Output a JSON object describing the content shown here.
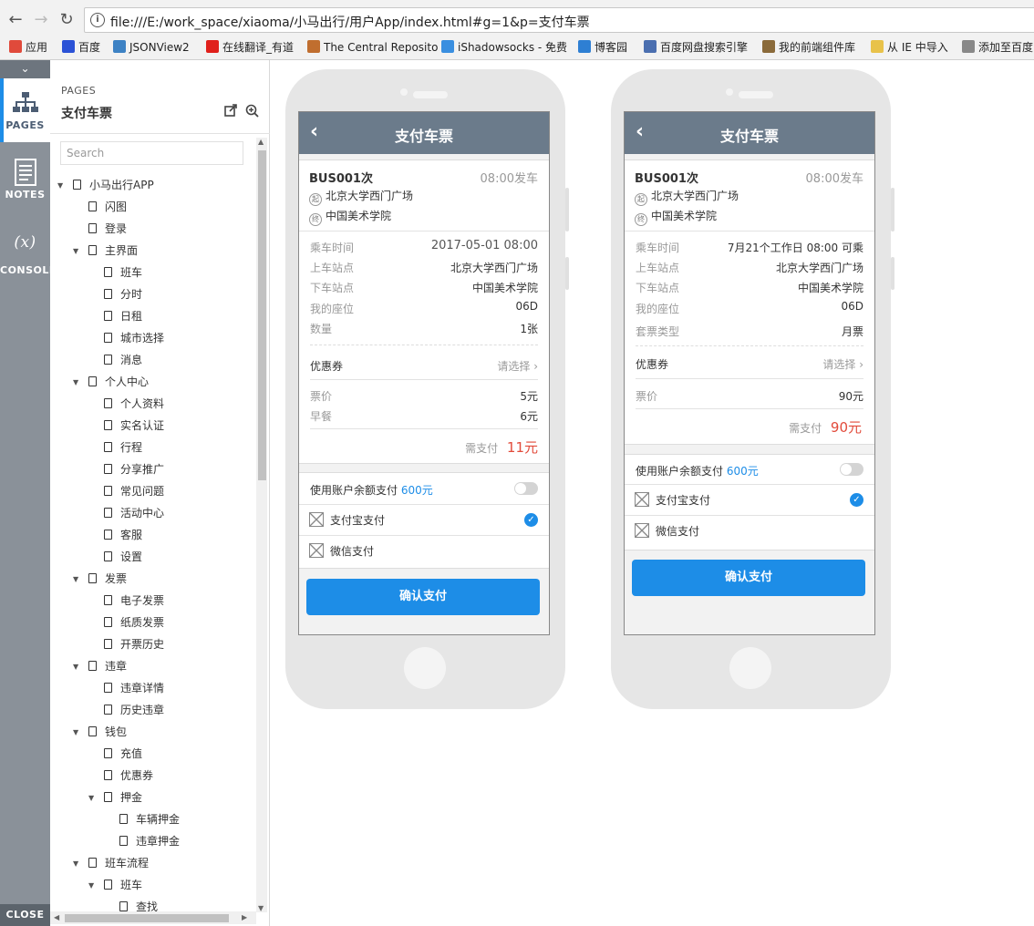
{
  "browser": {
    "url": "file:///E:/work_space/xiaoma/小马出行/用户App/index.html#g=1&p=支付车票",
    "bookmarks": [
      {
        "label": "应用",
        "color": "#e04a3b"
      },
      {
        "label": "百度",
        "color": "#2b52d6"
      },
      {
        "label": "JSONView2",
        "color": "#3d82c4"
      },
      {
        "label": "在线翻译_有道",
        "color": "#e0201b"
      },
      {
        "label": "The Central Reposito",
        "color": "#c06e2f"
      },
      {
        "label": "iShadowsocks - 免费",
        "color": "#3a8fe0"
      },
      {
        "label": "博客园",
        "color": "#2e7fd3"
      },
      {
        "label": "百度网盘搜索引擎",
        "color": "#4b6fb0"
      },
      {
        "label": "我的前端组件库",
        "color": "#8a6a3a"
      },
      {
        "label": "从 IE 中导入",
        "color": "#e8c24a"
      },
      {
        "label": "添加至百度",
        "color": "#888888"
      }
    ]
  },
  "iconbar": {
    "items": [
      {
        "label": "PAGES",
        "icon": "sitemap-icon"
      },
      {
        "label": "NOTES",
        "icon": "notes-icon"
      },
      {
        "label": "CONSOLE",
        "icon": "variable-icon",
        "glyph": "(x)"
      }
    ],
    "close_label": "CLOSE"
  },
  "pages_panel": {
    "section_label": "PAGES",
    "current_page": "支付车票",
    "search_placeholder": "Search",
    "tree": [
      {
        "label": "小马出行APP",
        "level": 0,
        "expanded": true
      },
      {
        "label": "闪图",
        "level": 1
      },
      {
        "label": "登录",
        "level": 1
      },
      {
        "label": "主界面",
        "level": 1,
        "expanded": true
      },
      {
        "label": "班车",
        "level": 2
      },
      {
        "label": "分时",
        "level": 2
      },
      {
        "label": "日租",
        "level": 2
      },
      {
        "label": "城市选择",
        "level": 2
      },
      {
        "label": "消息",
        "level": 2
      },
      {
        "label": "个人中心",
        "level": 1,
        "expanded": true
      },
      {
        "label": "个人资料",
        "level": 2
      },
      {
        "label": "实名认证",
        "level": 2
      },
      {
        "label": "行程",
        "level": 2
      },
      {
        "label": "分享推广",
        "level": 2
      },
      {
        "label": "常见问题",
        "level": 2
      },
      {
        "label": "活动中心",
        "level": 2
      },
      {
        "label": "客服",
        "level": 2
      },
      {
        "label": "设置",
        "level": 2
      },
      {
        "label": "发票",
        "level": 1,
        "expanded": true
      },
      {
        "label": "电子发票",
        "level": 2
      },
      {
        "label": "纸质发票",
        "level": 2
      },
      {
        "label": "开票历史",
        "level": 2
      },
      {
        "label": "违章",
        "level": 1,
        "expanded": true
      },
      {
        "label": "违章详情",
        "level": 2
      },
      {
        "label": "历史违章",
        "level": 2
      },
      {
        "label": "钱包",
        "level": 1,
        "expanded": true
      },
      {
        "label": "充值",
        "level": 2
      },
      {
        "label": "优惠券",
        "level": 2
      },
      {
        "label": "押金",
        "level": 2,
        "expanded": true
      },
      {
        "label": "车辆押金",
        "level": 3
      },
      {
        "label": "违章押金",
        "level": 3
      },
      {
        "label": "班车流程",
        "level": 1,
        "expanded": true
      },
      {
        "label": "班车",
        "level": 2,
        "expanded": true
      },
      {
        "label": "查找",
        "level": 3
      }
    ]
  },
  "phone1": {
    "title": "支付车票",
    "bus": "BUS001次",
    "depart": "08:00发车",
    "start_badge": "起",
    "start": "北京大学西门广场",
    "end_badge": "终",
    "end": "中国美术学院",
    "rows": [
      {
        "label": "乘车时间",
        "value": "2017-05-01 08:00"
      },
      {
        "label": "上车站点",
        "value": "北京大学西门广场"
      },
      {
        "label": "下车站点",
        "value": "中国美术学院"
      },
      {
        "label": "我的座位",
        "value": "06D"
      },
      {
        "label": "数量",
        "value": "1张"
      }
    ],
    "coupon_label": "优惠券",
    "coupon_value": "请选择",
    "prices": [
      {
        "label": "票价",
        "value": "5元"
      },
      {
        "label": "早餐",
        "value": "6元"
      }
    ],
    "total_label": "需支付",
    "total_value": "11元",
    "balance_label": "使用账户余额支付",
    "balance_value": "600元",
    "pay_alipay": "支付宝支付",
    "pay_wechat": "微信支付",
    "confirm": "确认支付"
  },
  "phone2": {
    "title": "支付车票",
    "bus": "BUS001次",
    "depart": "08:00发车",
    "start_badge": "起",
    "start": "北京大学西门广场",
    "end_badge": "终",
    "end": "中国美术学院",
    "rows": [
      {
        "label": "乘车时间",
        "value": "7月21个工作日 08:00 可乘"
      },
      {
        "label": "上车站点",
        "value": "北京大学西门广场"
      },
      {
        "label": "下车站点",
        "value": "中国美术学院"
      },
      {
        "label": "我的座位",
        "value": "06D"
      },
      {
        "label": "套票类型",
        "value": "月票"
      }
    ],
    "coupon_label": "优惠券",
    "coupon_value": "请选择",
    "prices": [
      {
        "label": "票价",
        "value": "90元"
      }
    ],
    "total_label": "需支付",
    "total_value": "90元",
    "balance_label": "使用账户余额支付",
    "balance_value": "600元",
    "pay_alipay": "支付宝支付",
    "pay_wechat": "微信支付",
    "confirm": "确认支付"
  }
}
